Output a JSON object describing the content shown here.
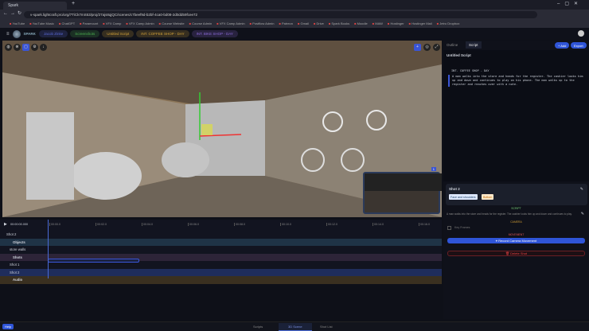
{
  "browser": {
    "tab_title": "Spark",
    "url": "v-spark.lightcraft.pro/org/7TiCk7mS53/proj/27ajs8qjQC/scenes/c7beef9d-b2bf-4ca0-bd08-2d0dd59fcee72",
    "bookmarks": [
      "YouTube",
      "YouTube Music",
      "ChatGPT",
      "Paramount",
      "VFX Camp",
      "VFX Camp Admin",
      "Course Website",
      "Course Admin",
      "VFX Camp Admin",
      "Postflow Admin",
      "Patreon",
      "Gmail",
      "Drive",
      "Spark Books",
      "Moodle",
      "MAW",
      "Hostinger",
      "Hostinger Mail",
      "Jetro Dropbox"
    ]
  },
  "app": {
    "logo": "SPARK",
    "breadcrumbs": [
      {
        "label": "Jacob Zinke",
        "color": "#5a6ad6"
      },
      {
        "label": "Screenshots",
        "color": "#4caf50"
      },
      {
        "label": "Untitled Script",
        "color": "#d4a43a"
      },
      {
        "label": "INT. COFFEE SHOP - DAY",
        "color": "#d4a43a"
      },
      {
        "label": "INT. BIKE SHOP - DAY",
        "color": "#8a6ad6"
      }
    ]
  },
  "viewport": {
    "tools": [
      "globe",
      "target",
      "select",
      "settings",
      "info"
    ],
    "pip_badge": "1"
  },
  "right": {
    "tabs": [
      "Outline",
      "Script"
    ],
    "active_tab": "Script",
    "add_label": "+ Add",
    "export_label": "Export",
    "script_title": "Untitled Script",
    "slug": "INT. COFFEE SHOP - DAY",
    "action": "A man walks into the store and heads for the register. The cashier looks him up and down and continues to play on his phone. The man walks up to the register and reaches over with a note.",
    "shot": {
      "title": "Shot 2",
      "tags": [
        "Face and shoulders",
        "Bottom"
      ],
      "script_label": "SCRIPT",
      "script_text": "A man walks into the store and heads for the register. The cashier looks him up and down and continues to play.",
      "camera_label": "CAMERA",
      "key_frames_label": "Key Frames",
      "movement_label": "MOVEMENT",
      "record_label": "Record Camera Movement",
      "delete_label": "Delete Shot"
    }
  },
  "timeline": {
    "time": "00:00:00.000",
    "ticks": [
      "00:00.0",
      "00:02.0",
      "00:04.0",
      "00:06.0",
      "00:08.0",
      "00:10.0",
      "00:12.0",
      "00:14.0",
      "00:16.0"
    ],
    "rows": [
      {
        "label": "Shot 2",
        "kind": "header"
      },
      {
        "label": "Objects",
        "kind": "group",
        "color": "#1f3346"
      },
      {
        "label": "store walls",
        "kind": "item"
      },
      {
        "label": "Shots",
        "kind": "group",
        "color": "#2d2438"
      },
      {
        "label": "Shot 1",
        "kind": "item"
      },
      {
        "label": "Shot 2",
        "kind": "selected",
        "color": "#1f2d5c"
      },
      {
        "label": "Audio",
        "kind": "group",
        "color": "#3a3020"
      }
    ]
  },
  "bottom": {
    "help": "Help",
    "tabs": [
      "Scripts",
      "3D Scene",
      "Shot List"
    ],
    "active": "3D Scene"
  }
}
